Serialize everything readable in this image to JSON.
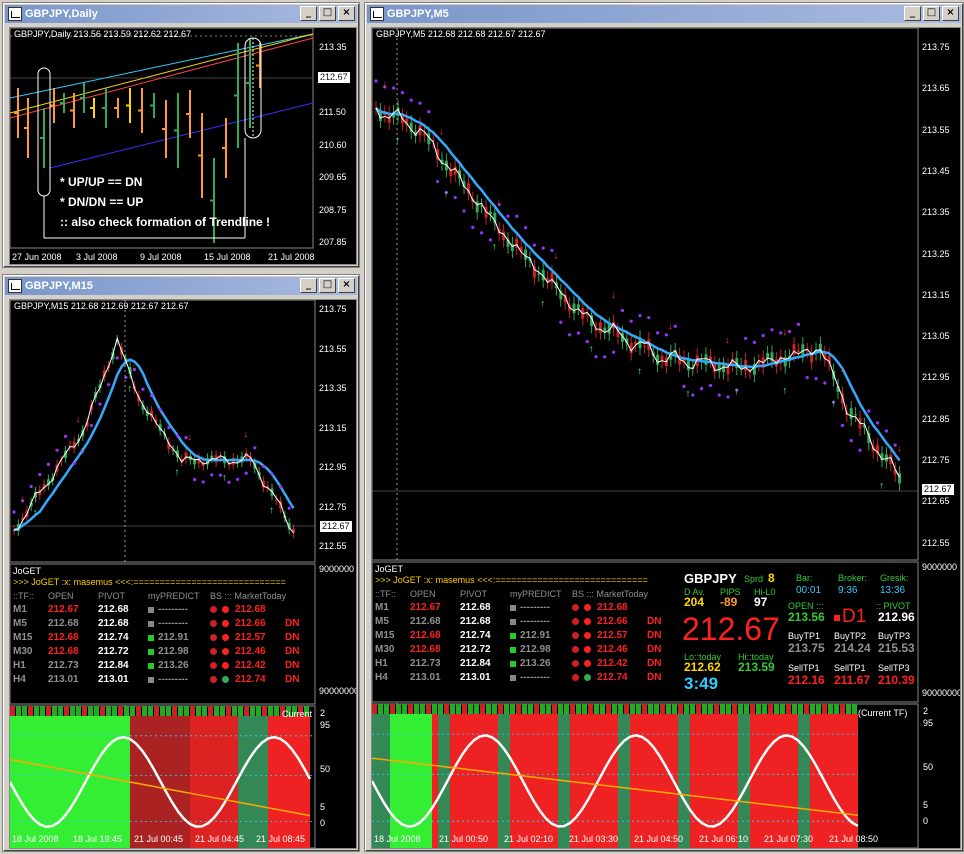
{
  "windows": {
    "daily": {
      "title": "GBPJPY,Daily",
      "header": "GBPJPY,Daily  213.56 213.59 212.62 212.67",
      "price": "212.67",
      "yticks": [
        "213.35",
        "212.45",
        "211.50",
        "210.60",
        "209.65",
        "208.75",
        "207.85"
      ],
      "xticks": [
        "27 Jun 2008",
        "3 Jul 2008",
        "9 Jul 2008",
        "15 Jul 2008",
        "21 Jul 2008"
      ],
      "notes": [
        "* UP/UP == DN",
        "* DN/DN == UP",
        ":: also check formation of Trendline !"
      ]
    },
    "m15": {
      "title": "GBPJPY,M15",
      "header": "GBPJPY,M15  212.68 212.69 212.67 212.67",
      "price": "212.67",
      "yticks": [
        "213.75",
        "213.55",
        "213.35",
        "213.15",
        "212.95",
        "212.75",
        "212.55"
      ],
      "xticks": [
        "18 Jul 2008",
        "18 Jul 19:45",
        "21 Jul 00:45",
        "21 Jul 04:45",
        "21 Jul 08:45"
      ],
      "osc_label": "Current",
      "osc_ticks": [
        "2",
        "95",
        "50",
        "5",
        "0"
      ]
    },
    "m5": {
      "title": "GBPJPY,M5",
      "header": "GBPJPY,M5  212.68 212.68 212.67 212.67",
      "price": "212.67",
      "yticks": [
        "213.75",
        "213.65",
        "213.55",
        "213.45",
        "213.35",
        "213.25",
        "213.15",
        "213.05",
        "212.95",
        "212.85",
        "212.75",
        "212.65",
        "212.55"
      ],
      "xticks": [
        "18 Jul 2008",
        "21 Jul 00:50",
        "21 Jul 02:10",
        "21 Jul 03:30",
        "21 Jul 04:50",
        "21 Jul 06:10",
        "21 Jul 07:30",
        "21 Jul 08:50"
      ],
      "osc_label": "(Current TF)",
      "osc_ticks": [
        "2",
        "95",
        "50",
        "5",
        "0"
      ]
    }
  },
  "joget": {
    "name": "JoGET",
    "banner": ">>> JoGET :x: masemus <<<:=============================",
    "headers": [
      "::TF::",
      "OPEN",
      "PIVOT",
      "myPREDICT",
      "BS ::: MarketToday"
    ],
    "rows": [
      {
        "tf": "M1",
        "open": "212.67",
        "pivot": "212.68",
        "pred": "---------",
        "market": "212.68",
        "dir": ""
      },
      {
        "tf": "M5",
        "open": "212.68",
        "pivot": "212.68",
        "pred": "---------",
        "market": "212.66",
        "dir": "DN"
      },
      {
        "tf": "M15",
        "open": "212.68",
        "pivot": "212.74",
        "pred": "212.91",
        "market": "212.57",
        "dir": "DN"
      },
      {
        "tf": "M30",
        "open": "212.68",
        "pivot": "212.72",
        "pred": "212.98",
        "market": "212.46",
        "dir": "DN"
      },
      {
        "tf": "H1",
        "open": "212.73",
        "pivot": "212.84",
        "pred": "213.26",
        "market": "212.42",
        "dir": "DN"
      },
      {
        "tf": "H4",
        "open": "213.01",
        "pivot": "213.01",
        "pred": "---------",
        "market": "212.74",
        "dir": "DN"
      }
    ],
    "scale_top": "9000000",
    "scale_bottom": "90000000"
  },
  "info": {
    "symbol": "GBPJPY",
    "sprd_label": "Sprd",
    "sprd": "8",
    "dav_label": "D Av.",
    "pips_label": "PIPS",
    "hilo_label": "Hi-L0",
    "dav": "204",
    "pips": "-89",
    "hilo": "97",
    "big_price": "212.67",
    "lo_label": "Lo::today",
    "hi_label": "Hi::today",
    "lo": "212.62",
    "hi": "213.59",
    "time": "3:49",
    "bar_label": "Bar:",
    "bar": "00:01",
    "broker_label": "Broker:",
    "broker": "9:36",
    "gresik_label": "Gresik:",
    "gresik": "13:36",
    "open_label": "OPEN :::",
    "open": "213.56",
    "d1": "D1",
    "pivot_label": ":: PIVOT",
    "pivot": "212.96",
    "buy_labels": [
      "BuyTP1",
      "BuyTP2",
      "BuyTP3"
    ],
    "buy": [
      "213.75",
      "214.24",
      "215.53"
    ],
    "sell_labels": [
      "SellTP1",
      "SellTP1",
      "SellTP3"
    ],
    "sell": [
      "212.16",
      "211.67",
      "210.39"
    ]
  }
}
